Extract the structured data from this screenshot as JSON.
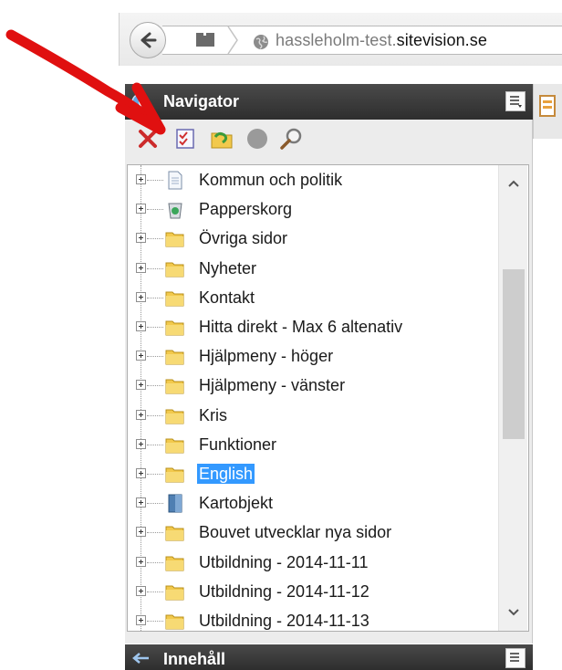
{
  "browser": {
    "url_prefix": "hassleholm-test.",
    "url_bold": "sitevision.se"
  },
  "navigator": {
    "title": "Navigator",
    "toolbar": [
      "delete-icon",
      "checklist-icon",
      "publish-icon",
      "status-dot-icon",
      "search-icon"
    ],
    "tree_items": [
      {
        "label": "Kommun och politik",
        "icon": "page-icon"
      },
      {
        "label": "Papperskorg",
        "icon": "trash-icon"
      },
      {
        "label": "Övriga sidor",
        "icon": "folder-icon"
      },
      {
        "label": "Nyheter",
        "icon": "folder-icon"
      },
      {
        "label": "Kontakt",
        "icon": "folder-icon"
      },
      {
        "label": "Hitta direkt - Max 6 altenativ",
        "icon": "folder-icon"
      },
      {
        "label": "Hjälpmeny - höger",
        "icon": "folder-icon"
      },
      {
        "label": "Hjälpmeny - vänster",
        "icon": "folder-icon"
      },
      {
        "label": "Kris",
        "icon": "folder-icon"
      },
      {
        "label": "Funktioner",
        "icon": "folder-icon"
      },
      {
        "label": "English",
        "icon": "folder-icon",
        "selected": true
      },
      {
        "label": "Kartobjekt",
        "icon": "archive-icon"
      },
      {
        "label": "Bouvet utvecklar nya sidor",
        "icon": "folder-icon"
      },
      {
        "label": "Utbildning - 2014-11-11",
        "icon": "folder-icon"
      },
      {
        "label": "Utbildning - 2014-11-12",
        "icon": "folder-icon"
      },
      {
        "label": "Utbildning - 2014-11-13",
        "icon": "folder-icon"
      }
    ]
  },
  "content_panel": {
    "title": "Innehåll"
  },
  "colors": {
    "header_bg": "#3a3a3a",
    "selection": "#3399ff",
    "folder": "#f2c94c",
    "annotation_arrow": "#e01010"
  }
}
